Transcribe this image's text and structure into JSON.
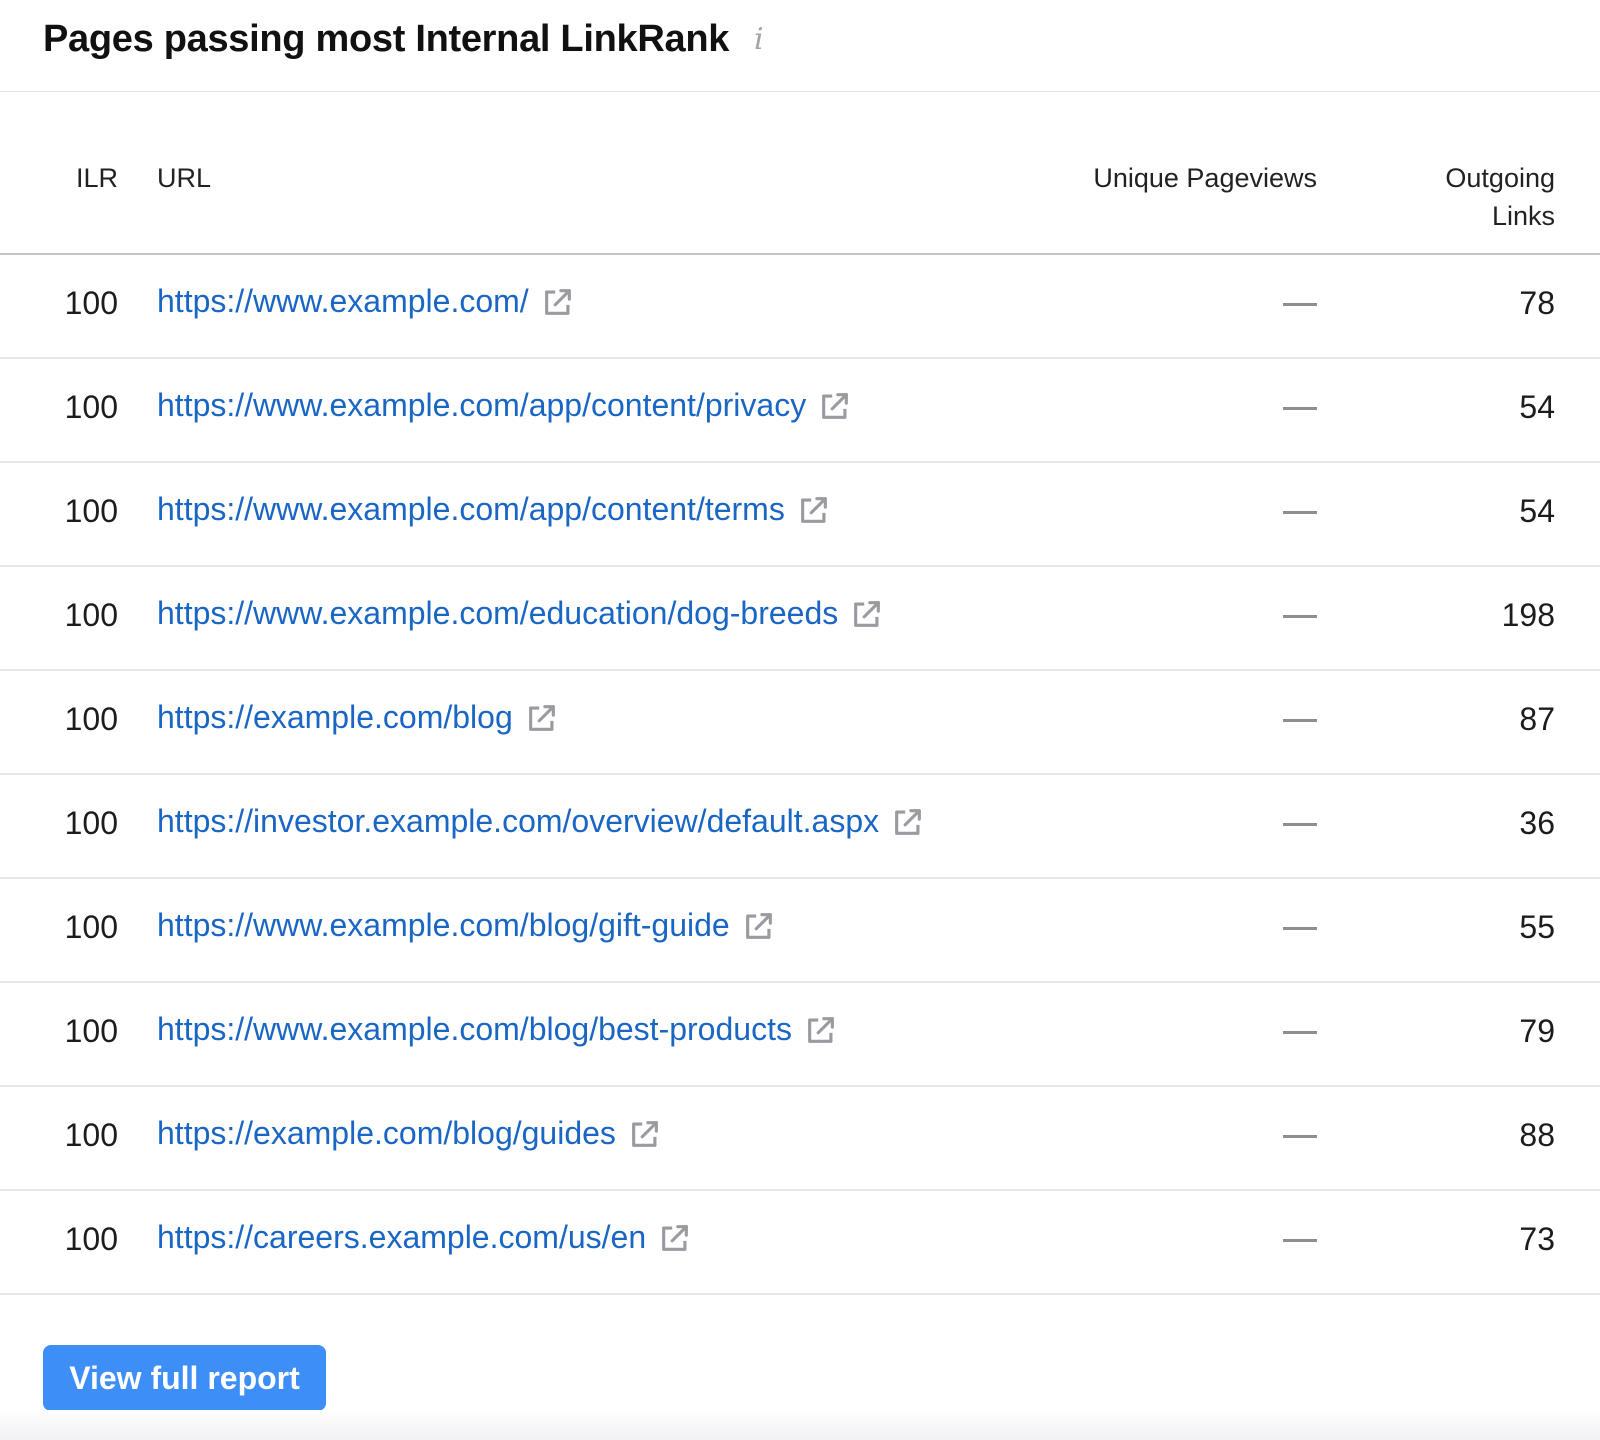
{
  "widget": {
    "title": "Pages passing most Internal LinkRank",
    "info_icon": "info-icon",
    "info_glyph": "i"
  },
  "table": {
    "columns": {
      "ilr": "ILR",
      "url": "URL",
      "pageviews": "Unique Pageviews",
      "outgoing": "Outgoing Links"
    },
    "rows": [
      {
        "ilr": "100",
        "url": "https://www.example.com/",
        "pageviews": "—",
        "outgoing": "78"
      },
      {
        "ilr": "100",
        "url": "https://www.example.com/app/content/privacy",
        "pageviews": "—",
        "outgoing": "54"
      },
      {
        "ilr": "100",
        "url": "https://www.example.com/app/content/terms",
        "pageviews": "—",
        "outgoing": "54"
      },
      {
        "ilr": "100",
        "url": "https://www.example.com/education/dog-breeds",
        "pageviews": "—",
        "outgoing": "198"
      },
      {
        "ilr": "100",
        "url": "https://example.com/blog",
        "pageviews": "—",
        "outgoing": "87"
      },
      {
        "ilr": "100",
        "url": "https://investor.example.com/overview/default.aspx",
        "pageviews": "—",
        "outgoing": "36"
      },
      {
        "ilr": "100",
        "url": "https://www.example.com/blog/gift-guide",
        "pageviews": "—",
        "outgoing": "55"
      },
      {
        "ilr": "100",
        "url": "https://www.example.com/blog/best-products",
        "pageviews": "—",
        "outgoing": "79"
      },
      {
        "ilr": "100",
        "url": "https://example.com/blog/guides",
        "pageviews": "—",
        "outgoing": "88"
      },
      {
        "ilr": "100",
        "url": "https://careers.example.com/us/en",
        "pageviews": "—",
        "outgoing": "73"
      }
    ]
  },
  "footer": {
    "view_report_label": "View full report"
  },
  "colors": {
    "link": "#1a66c4",
    "button": "#3d8ef6",
    "icon_gray": "#a3a3a8"
  },
  "icons": {
    "external_link": "external-link-icon"
  }
}
